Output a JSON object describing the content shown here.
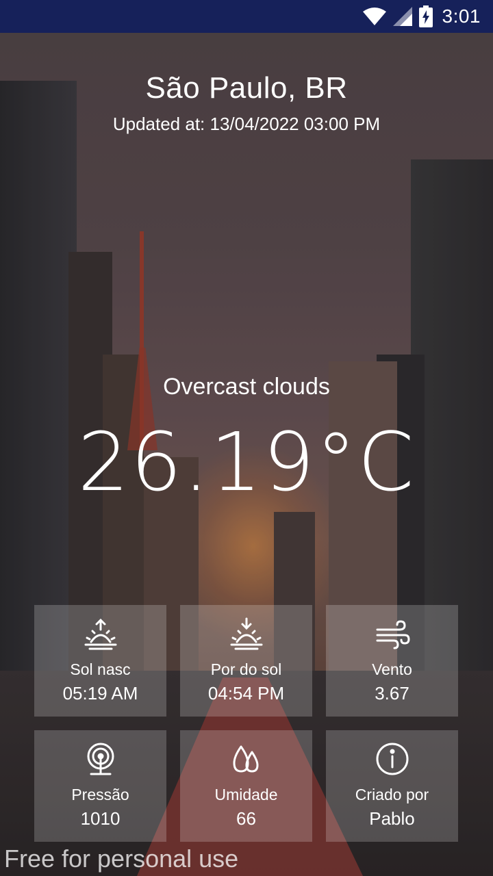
{
  "status_bar": {
    "time": "3:01"
  },
  "location": {
    "city": "São Paulo, BR",
    "updated": "Updated at: 13/04/2022 03:00 PM"
  },
  "weather": {
    "description": "Overcast clouds",
    "temperature": "26.19°C"
  },
  "tiles": [
    {
      "label": "Sol nasc",
      "value": "05:19 AM",
      "icon": "sunrise-icon"
    },
    {
      "label": "Por do sol",
      "value": "04:54 PM",
      "icon": "sunset-icon"
    },
    {
      "label": "Vento",
      "value": "3.67",
      "icon": "wind-icon"
    },
    {
      "label": "Pressão",
      "value": "1010",
      "icon": "pressure-icon"
    },
    {
      "label": "Umidade",
      "value": "66",
      "icon": "humidity-icon"
    },
    {
      "label": "Criado por",
      "value": "Pablo",
      "icon": "info-icon"
    }
  ],
  "footer": {
    "watermark": "Free for personal use"
  },
  "colors": {
    "status_bar": "#16215a",
    "tile_bg": "rgba(255,255,255,0.2)",
    "text": "#ffffff"
  }
}
